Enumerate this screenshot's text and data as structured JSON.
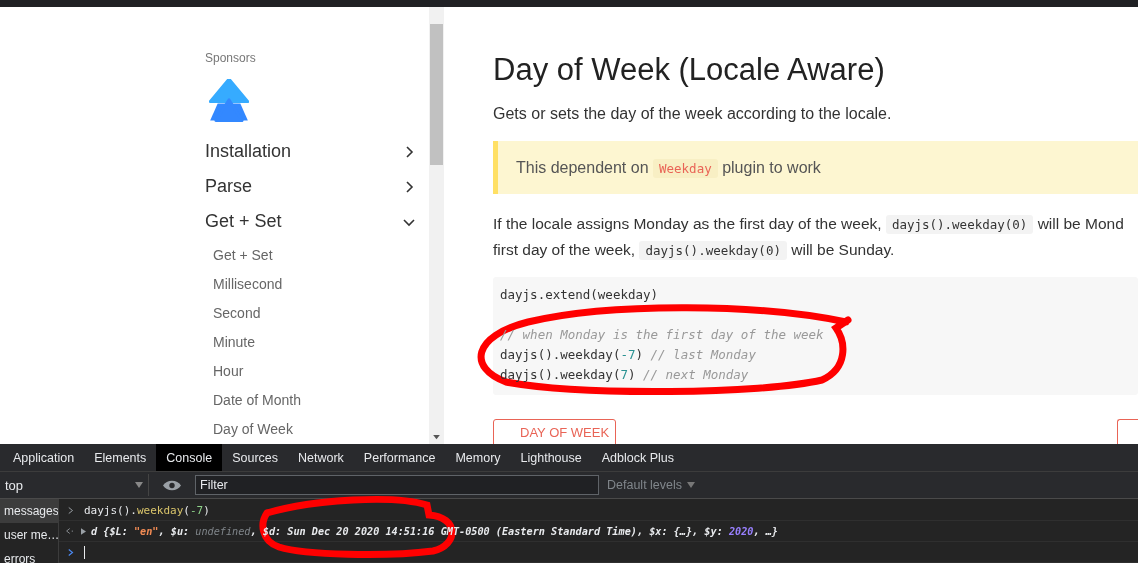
{
  "sidebar": {
    "sponsors_label": "Sponsors",
    "sections": [
      {
        "label": "Installation",
        "expanded": false
      },
      {
        "label": "Parse",
        "expanded": false
      },
      {
        "label": "Get + Set",
        "expanded": true,
        "children": [
          {
            "label": "Get + Set"
          },
          {
            "label": "Millisecond"
          },
          {
            "label": "Second"
          },
          {
            "label": "Minute"
          },
          {
            "label": "Hour"
          },
          {
            "label": "Date of Month"
          },
          {
            "label": "Day of Week"
          }
        ]
      }
    ]
  },
  "article": {
    "title": "Day of Week (Locale Aware)",
    "intro": "Gets or sets the day of the week according to the locale.",
    "callout": [
      {
        "text": "This dependent on ",
        "kind": "plain"
      },
      {
        "text": "Weekday",
        "kind": "code"
      },
      {
        "text": " plugin to work",
        "kind": "plain"
      }
    ],
    "paragraph_lines": [
      [
        {
          "text": "If the locale assigns Monday as the first day of the week, ",
          "kind": "plain"
        },
        {
          "text": "dayjs().weekday(0)",
          "kind": "code"
        },
        {
          "text": " will be Mond",
          "kind": "plain"
        }
      ],
      [
        {
          "text": "first day of the week, ",
          "kind": "plain"
        },
        {
          "text": "dayjs().weekday(0)",
          "kind": "code"
        },
        {
          "text": " will be Sunday.",
          "kind": "plain"
        }
      ]
    ],
    "code_groups": [
      [
        {
          "parts": [
            {
              "text": "dayjs.extend(weekday)",
              "kind": "plain"
            }
          ]
        }
      ],
      [
        {
          "parts": [
            {
              "text": "// when Monday is the first day of the week",
              "kind": "comment"
            }
          ]
        },
        {
          "parts": [
            {
              "text": "dayjs().weekday(",
              "kind": "plain"
            },
            {
              "text": "-7",
              "kind": "number"
            },
            {
              "text": ") ",
              "kind": "plain"
            },
            {
              "text": "// last Monday",
              "kind": "comment"
            }
          ]
        },
        {
          "parts": [
            {
              "text": "dayjs().weekday(",
              "kind": "plain"
            },
            {
              "text": "7",
              "kind": "number"
            },
            {
              "text": ") ",
              "kind": "plain"
            },
            {
              "text": "// next Monday",
              "kind": "comment"
            }
          ]
        }
      ]
    ],
    "prev_button": "DAY OF WEEK"
  },
  "devtools": {
    "tabs": [
      {
        "label": "Application",
        "selected": false
      },
      {
        "label": "Elements",
        "selected": false
      },
      {
        "label": "Console",
        "selected": true
      },
      {
        "label": "Sources",
        "selected": false
      },
      {
        "label": "Network",
        "selected": false
      },
      {
        "label": "Performance",
        "selected": false
      },
      {
        "label": "Memory",
        "selected": false
      },
      {
        "label": "Lighthouse",
        "selected": false
      },
      {
        "label": "Adblock Plus",
        "selected": false
      }
    ],
    "context": "top",
    "filter_placeholder": "Filter",
    "levels": "Default levels",
    "sidebar": [
      {
        "label": "messages",
        "selected": true
      },
      {
        "label": "user me…",
        "selected": false
      },
      {
        "label": "errors",
        "selected": false
      }
    ],
    "input_line": [
      {
        "text": "dayjs().",
        "kind": "plain"
      },
      {
        "text": "weekday",
        "kind": "method"
      },
      {
        "text": "(",
        "kind": "plain"
      },
      {
        "text": "-7",
        "kind": "number"
      },
      {
        "text": ")",
        "kind": "plain"
      }
    ],
    "output_line": [
      {
        "text": "d {$L: ",
        "kind": "object"
      },
      {
        "text": "\"en\"",
        "kind": "string"
      },
      {
        "text": ", $u: ",
        "kind": "object"
      },
      {
        "text": "undefined",
        "kind": "undefined"
      },
      {
        "text": ", $d: Sun Dec 20 2020 14:51:16 GMT-0500 (Eastern Standard Time), $x: {…}, $y: ",
        "kind": "object"
      },
      {
        "text": "2020",
        "kind": "year"
      },
      {
        "text": ", …}",
        "kind": "object"
      }
    ]
  },
  "annotations": [
    {
      "kind": "loop"
    },
    {
      "kind": "loop"
    }
  ]
}
